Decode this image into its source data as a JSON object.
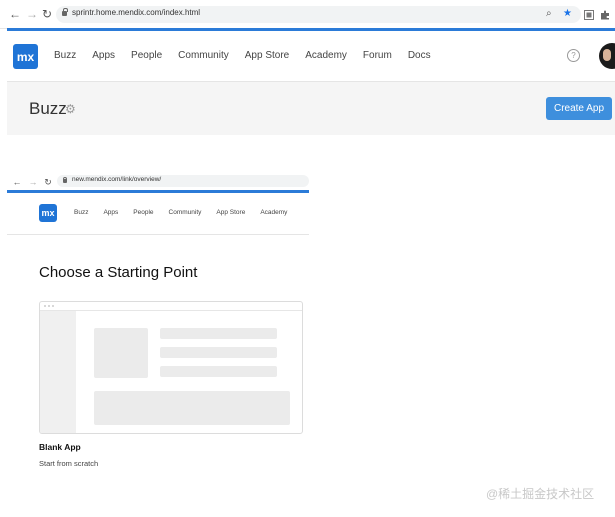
{
  "top_browser": {
    "url": "sprintr.home.mendix.com/index.html"
  },
  "top_app": {
    "logo": "mx",
    "nav": [
      "Buzz",
      "Apps",
      "People",
      "Community",
      "App Store",
      "Academy",
      "Forum",
      "Docs"
    ],
    "help": "?",
    "page_title": "Buzz",
    "create_button": "Create App"
  },
  "inner_browser": {
    "url": "new.mendix.com/link/overview/"
  },
  "inner_app": {
    "logo": "mx",
    "nav": [
      "Buzz",
      "Apps",
      "People",
      "Community",
      "App Store",
      "Academy"
    ],
    "heading": "Choose a Starting Point",
    "card_title": "Blank App",
    "card_subtitle": "Start from scratch"
  },
  "watermark": "@稀土掘金技术社区",
  "colors": {
    "accent": "#2b7bd8",
    "logo_bg": "#1f74d6",
    "button_bg": "#3e8fdd"
  }
}
